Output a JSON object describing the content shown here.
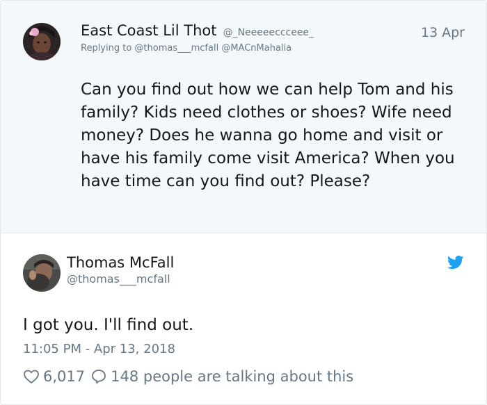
{
  "reply_tweet": {
    "display_name": "East Coast Lil Thot",
    "handle": "@_Neeeeeccceee_",
    "date": "13 Apr",
    "replying_to": "Replying to @thomas___mcfall @MACnMahalia",
    "text": "Can you find out how we can help Tom and his family? Kids need clothes or shoes? Wife need money? Does he wanna go home and visit or have his family come visit America? When you have time can you find out? Please?"
  },
  "main_tweet": {
    "display_name": "Thomas McFall",
    "handle": "@thomas___mcfall",
    "text": "I got you. I'll find out.",
    "timestamp": "11:05 PM - Apr 13, 2018",
    "likes": "6,017",
    "talking": "148 people are talking about this"
  },
  "icons": {
    "brand": "twitter-bird-icon",
    "like": "heart-icon",
    "reply": "speech-bubble-icon"
  },
  "colors": {
    "twitter_blue": "#1da1f2",
    "secondary_text": "#657786",
    "reply_background": "#f5f8fa"
  }
}
